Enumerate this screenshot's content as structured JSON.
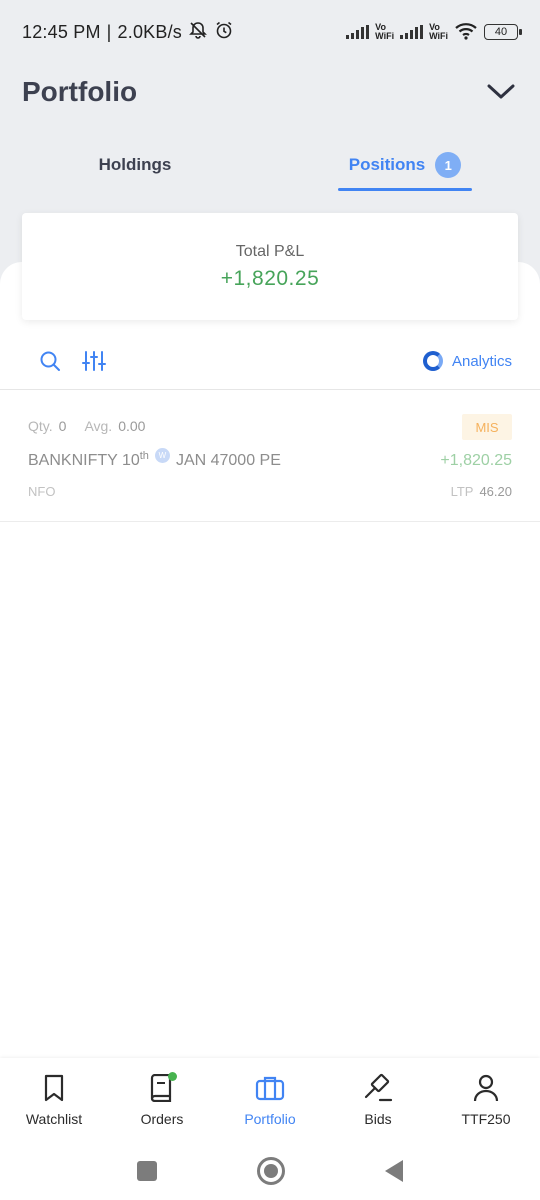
{
  "status_bar": {
    "time": "12:45 PM",
    "separator": "|",
    "speed": "2.0KB/s",
    "vo_label": "Vo",
    "wifi_label": "WiFi",
    "battery": "40"
  },
  "header": {
    "title": "Portfolio"
  },
  "tabs": [
    {
      "label": "Holdings"
    },
    {
      "label": "Positions",
      "badge": "1"
    }
  ],
  "summary": {
    "label": "Total P&L",
    "value": "+1,820.25"
  },
  "toolbar": {
    "analytics_label": "Analytics"
  },
  "positions": [
    {
      "qty_label": "Qty.",
      "qty": "0",
      "avg_label": "Avg.",
      "avg": "0.00",
      "product": "MIS",
      "symbol": "BANKNIFTY 10",
      "day_suffix": "th",
      "weekly_marker": "W",
      "contract": "JAN 47000 PE",
      "pnl": "+1,820.25",
      "exchange": "NFO",
      "ltp_label": "LTP",
      "ltp": "46.20"
    }
  ],
  "bottom_nav": [
    {
      "label": "Watchlist",
      "icon": "bookmark-icon"
    },
    {
      "label": "Orders",
      "icon": "book-icon"
    },
    {
      "label": "Portfolio",
      "icon": "briefcase-icon",
      "active": true
    },
    {
      "label": "Bids",
      "icon": "gavel-icon"
    },
    {
      "label": "TTF250",
      "icon": "user-icon"
    }
  ],
  "colors": {
    "accent": "#4184f3",
    "profit": "#47a45a",
    "mis_tag": "#f5b15c"
  }
}
